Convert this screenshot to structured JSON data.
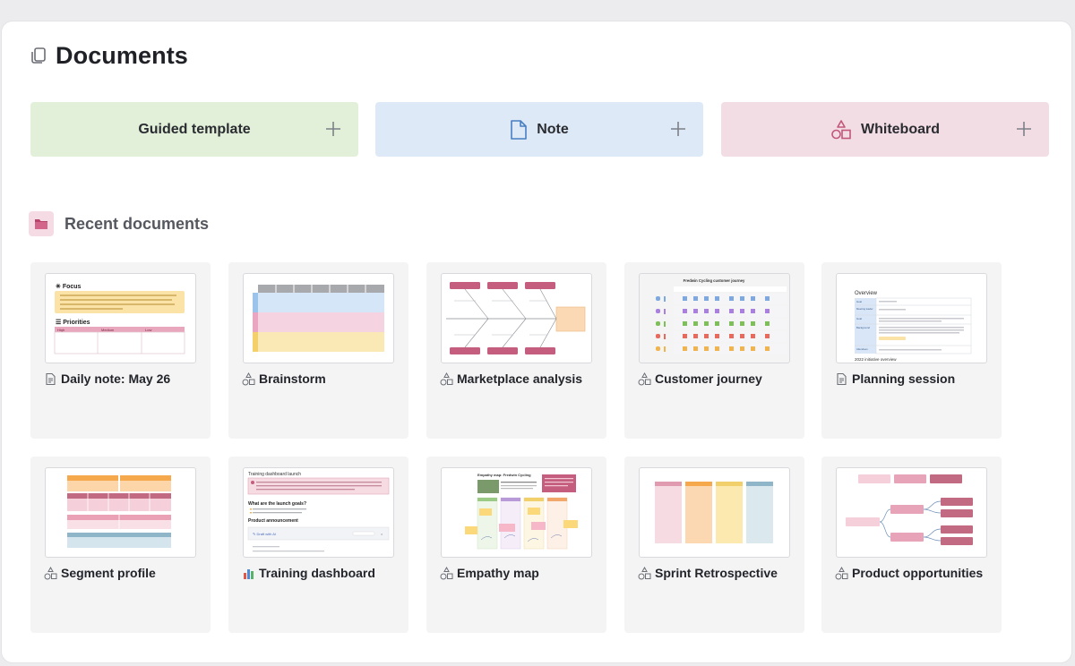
{
  "page": {
    "title": "Documents"
  },
  "create": [
    {
      "label": "Guided template",
      "icon": "plus-icon",
      "color": "#e2f0d9"
    },
    {
      "label": "Note",
      "icon": "document-icon",
      "color": "#dde9f7"
    },
    {
      "label": "Whiteboard",
      "icon": "shapes-icon",
      "color": "#f3dde4"
    }
  ],
  "recent": {
    "title": "Recent documents",
    "icon": "folder-icon",
    "cards": [
      {
        "title": "Daily note: May 26",
        "icon": "document-icon"
      },
      {
        "title": "Brainstorm",
        "icon": "shapes-icon"
      },
      {
        "title": "Marketplace analysis",
        "icon": "shapes-icon"
      },
      {
        "title": "Customer journey",
        "icon": "shapes-icon"
      },
      {
        "title": "Planning session",
        "icon": "document-icon"
      },
      {
        "title": "Segment profile",
        "icon": "shapes-icon"
      },
      {
        "title": "Training dashboard",
        "icon": "chart-icon"
      },
      {
        "title": "Empathy map",
        "icon": "shapes-icon"
      },
      {
        "title": "Sprint Retrospective",
        "icon": "shapes-icon"
      },
      {
        "title": "Product opportunities",
        "icon": "shapes-icon"
      }
    ]
  },
  "thumbs": {
    "daily": {
      "focus": "Focus",
      "priorities": "Priorities",
      "cols": [
        "High",
        "Medium",
        "Low"
      ]
    },
    "journey": {
      "heading": "Fredwin Cycling customer journey"
    },
    "planning": {
      "heading": "Overview",
      "rows": [
        "Goal",
        "Meeting leader",
        "Goal",
        "Background",
        "Attendees"
      ],
      "footer": "2022 initiative overview"
    },
    "training": {
      "heading": "Training dashboard launch",
      "q1": "What are the launch goals?",
      "q2": "Product announcement",
      "ai": "Draft with AI"
    },
    "empathy": {
      "heading": "Empathy map: Fredwin Cycling"
    }
  }
}
